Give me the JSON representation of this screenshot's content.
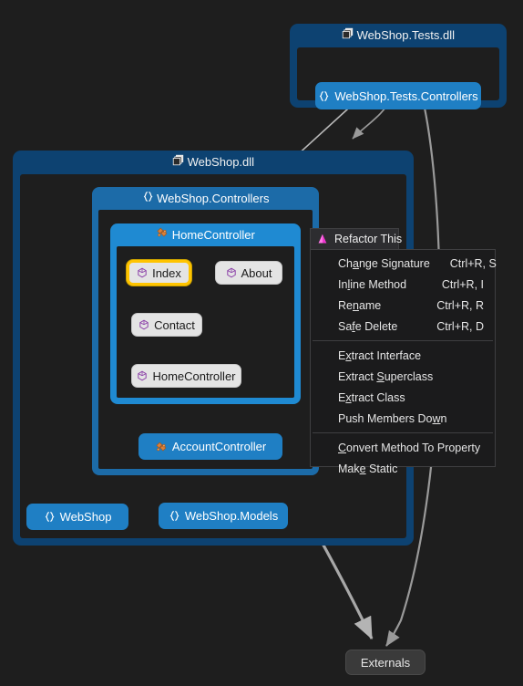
{
  "canvas": {
    "background": "#1e1e1e",
    "edge_color": "#9a9a9a"
  },
  "graph": {
    "assemblies": [
      {
        "id": "tests-dll",
        "label": "WebShop.Tests.dll",
        "icon": "assembly-icon",
        "color": "#0d4271",
        "children": [
          {
            "id": "tests-controllers",
            "label": "WebShop.Tests.Controllers",
            "icon": "namespace-braces-icon",
            "kind": "namespace-node",
            "color": "#1f7fc4"
          }
        ]
      },
      {
        "id": "webshop-dll",
        "label": "WebShop.dll",
        "icon": "assembly-icon",
        "color": "#0d4271"
      }
    ],
    "namespaces": [
      {
        "id": "webshop-controllers",
        "label": "WebShop.Controllers",
        "icon": "namespace-braces-icon",
        "color": "#1c6ba8"
      }
    ],
    "classes": [
      {
        "id": "home-controller",
        "label": "HomeController",
        "icon": "class-icon",
        "color": "#1f8ad2"
      }
    ],
    "members": [
      {
        "id": "index",
        "label": "Index",
        "icon": "method-cube-icon",
        "selected": true
      },
      {
        "id": "about",
        "label": "About",
        "icon": "method-cube-icon",
        "selected": false
      },
      {
        "id": "contact",
        "label": "Contact",
        "icon": "method-cube-icon",
        "selected": false
      },
      {
        "id": "homecontroller-ctor",
        "label": "HomeController",
        "icon": "method-cube-icon",
        "selected": false
      }
    ],
    "nodes": [
      {
        "id": "account-controller",
        "label": "AccountController",
        "icon": "class-icon",
        "kind": "class-node"
      },
      {
        "id": "webshop-ns",
        "label": "WebShop",
        "icon": "namespace-braces-icon",
        "kind": "namespace-node"
      },
      {
        "id": "webshop-models",
        "label": "WebShop.Models",
        "icon": "namespace-braces-icon",
        "kind": "namespace-node"
      },
      {
        "id": "externals",
        "label": "Externals",
        "icon": "none",
        "kind": "externals-node"
      }
    ]
  },
  "context_menu": {
    "title": "Refactor This",
    "title_icon": "refactor-triangle-icon",
    "groups": [
      {
        "items": [
          {
            "label": "Change Signature",
            "mnemonic_index": 2,
            "shortcut": "Ctrl+R, S"
          },
          {
            "label": "Inline Method",
            "mnemonic_index": 2,
            "shortcut": "Ctrl+R, I"
          },
          {
            "label": "Rename",
            "mnemonic_index": 2,
            "shortcut": "Ctrl+R, R"
          },
          {
            "label": "Safe Delete",
            "mnemonic_index": 2,
            "shortcut": "Ctrl+R, D"
          }
        ]
      },
      {
        "items": [
          {
            "label": "Extract Interface",
            "mnemonic_index": 1,
            "shortcut": ""
          },
          {
            "label": "Extract Superclass",
            "mnemonic_index": 8,
            "shortcut": ""
          },
          {
            "label": "Extract Class",
            "mnemonic_index": 1,
            "shortcut": ""
          },
          {
            "label": "Push Members Down",
            "mnemonic_index": 15,
            "shortcut": ""
          }
        ]
      },
      {
        "items": [
          {
            "label": "Convert Method To Property",
            "mnemonic_index": 0,
            "shortcut": ""
          },
          {
            "label": "Make Static",
            "mnemonic_index": 3,
            "shortcut": ""
          }
        ]
      }
    ]
  }
}
